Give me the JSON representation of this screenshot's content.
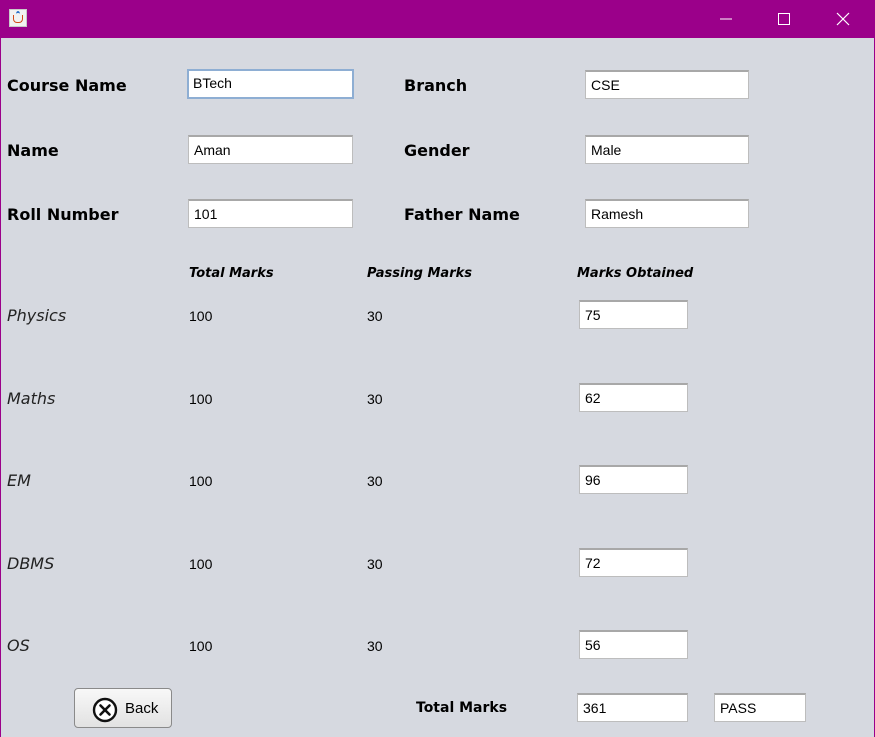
{
  "window": {
    "controls": {
      "minimize_icon": "minimize-icon",
      "maximize_icon": "maximize-icon",
      "close_icon": "close-icon"
    },
    "titlebar_color": "#9b008a"
  },
  "form": {
    "course_name": {
      "label": "Course Name",
      "value": "BTech"
    },
    "branch": {
      "label": "Branch",
      "value": "CSE"
    },
    "name": {
      "label": "Name",
      "value": "Aman"
    },
    "gender": {
      "label": "Gender",
      "value": "Male"
    },
    "roll_number": {
      "label": "Roll Number",
      "value": "101"
    },
    "father_name": {
      "label": "Father Name",
      "value": "Ramesh"
    }
  },
  "marks": {
    "headers": {
      "total": "Total Marks",
      "passing": "Passing Marks",
      "obtained": "Marks Obtained"
    },
    "subjects": [
      {
        "name": "Physics",
        "total": "100",
        "passing": "30",
        "obtained": "75"
      },
      {
        "name": "Maths",
        "total": "100",
        "passing": "30",
        "obtained": "62"
      },
      {
        "name": "EM",
        "total": "100",
        "passing": "30",
        "obtained": "96"
      },
      {
        "name": "DBMS",
        "total": "100",
        "passing": "30",
        "obtained": "72"
      },
      {
        "name": "OS",
        "total": "100",
        "passing": "30",
        "obtained": "56"
      }
    ]
  },
  "footer": {
    "back_label": "Back",
    "back_icon": "close-circle-icon",
    "total_label": "Total Marks",
    "total_value": "361",
    "result_value": "PASS"
  }
}
